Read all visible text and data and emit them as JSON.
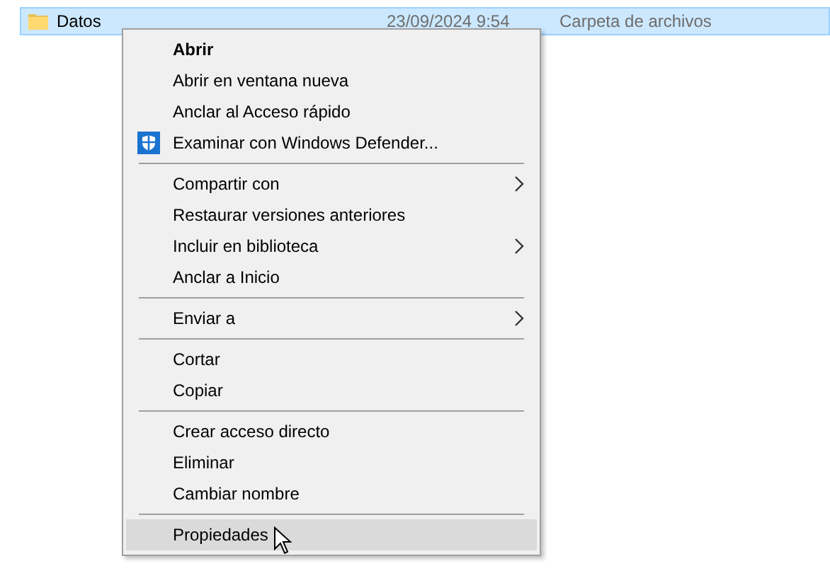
{
  "file_row": {
    "name": "Datos",
    "date": "23/09/2024 9:54",
    "type": "Carpeta de archivos",
    "selected": true
  },
  "context_menu": {
    "items": [
      {
        "kind": "item",
        "label": "Abrir",
        "bold": true,
        "submenu": false,
        "selected": false
      },
      {
        "kind": "item",
        "label": "Abrir en ventana nueva",
        "bold": false,
        "submenu": false,
        "selected": false
      },
      {
        "kind": "item",
        "label": "Anclar al Acceso rápido",
        "bold": false,
        "submenu": false,
        "selected": false
      },
      {
        "kind": "icon_item",
        "label": "Examinar con Windows Defender...",
        "bold": false,
        "submenu": false,
        "selected": false
      },
      {
        "kind": "separator"
      },
      {
        "kind": "item",
        "label": "Compartir con",
        "bold": false,
        "submenu": true,
        "selected": false
      },
      {
        "kind": "item",
        "label": "Restaurar versiones anteriores",
        "bold": false,
        "submenu": false,
        "selected": false
      },
      {
        "kind": "item",
        "label": "Incluir en biblioteca",
        "bold": false,
        "submenu": true,
        "selected": false
      },
      {
        "kind": "item",
        "label": "Anclar a Inicio",
        "bold": false,
        "submenu": false,
        "selected": false
      },
      {
        "kind": "separator"
      },
      {
        "kind": "item",
        "label": "Enviar a",
        "bold": false,
        "submenu": true,
        "selected": false
      },
      {
        "kind": "separator"
      },
      {
        "kind": "item",
        "label": "Cortar",
        "bold": false,
        "submenu": false,
        "selected": false
      },
      {
        "kind": "item",
        "label": "Copiar",
        "bold": false,
        "submenu": false,
        "selected": false
      },
      {
        "kind": "separator"
      },
      {
        "kind": "item",
        "label": "Crear acceso directo",
        "bold": false,
        "submenu": false,
        "selected": false
      },
      {
        "kind": "item",
        "label": "Eliminar",
        "bold": false,
        "submenu": false,
        "selected": false
      },
      {
        "kind": "item",
        "label": "Cambiar nombre",
        "bold": false,
        "submenu": false,
        "selected": false
      },
      {
        "kind": "separator"
      },
      {
        "kind": "item",
        "label": "Propiedades",
        "bold": false,
        "submenu": false,
        "selected": true
      }
    ]
  }
}
